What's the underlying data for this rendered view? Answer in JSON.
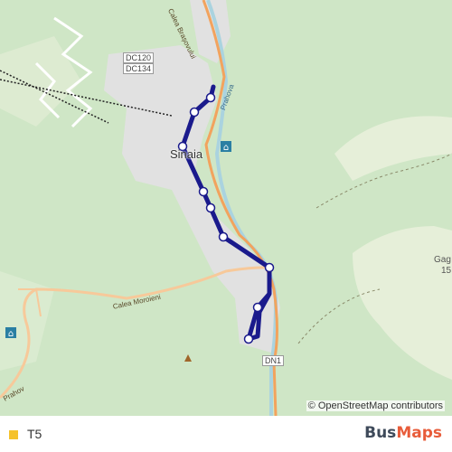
{
  "map": {
    "road_labels": [
      "DC120",
      "DC134",
      "DN1"
    ],
    "town_label": "Sinaia",
    "street_labels": [
      "Calea Moroieni",
      "Calea Brașovului",
      "Prahova"
    ],
    "peak_label": "Gag",
    "peak_elevation": "15",
    "lower_left_label": "Prahov",
    "attribution": "© OpenStreetMap contributors",
    "colors": {
      "forest": "#cfe6c6",
      "meadow": "#e6efd9",
      "urban": "#e1e1e1",
      "route": "#1a1a8c",
      "river": "#aad3df"
    }
  },
  "legend": {
    "route_name": "T5",
    "route_color": "#f5c22b"
  },
  "brand": {
    "part1": "Bus",
    "part2": "Maps"
  }
}
